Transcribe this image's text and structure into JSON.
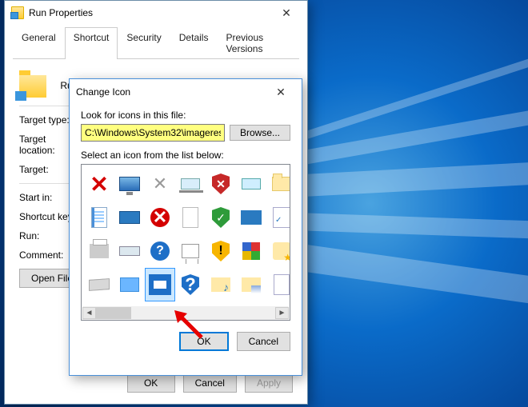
{
  "wallpaper": {
    "accent": "#0078d7"
  },
  "properties_window": {
    "title": "Run Properties",
    "tabs": [
      "General",
      "Shortcut",
      "Security",
      "Details",
      "Previous Versions"
    ],
    "active_tab": "Shortcut",
    "shortcut_name": "Run",
    "fields": {
      "target_type_label": "Target type:",
      "target_location_label": "Target location:",
      "target_label": "Target:",
      "start_in_label": "Start in:",
      "shortcut_key_label": "Shortcut key:",
      "run_label": "Run:",
      "comment_label": "Comment:"
    },
    "buttons": {
      "open_file_location": "Open File Location",
      "ok": "OK",
      "cancel": "Cancel",
      "apply": "Apply"
    }
  },
  "change_icon_dialog": {
    "title": "Change Icon",
    "look_for_label": "Look for icons in this file:",
    "path_value": "C:\\Windows\\System32\\imageres.dll",
    "browse_label": "Browse...",
    "select_label": "Select an icon from the list below:",
    "selected_index": 16,
    "ok_label": "OK",
    "cancel_label": "Cancel",
    "icons": [
      "red-x",
      "monitor",
      "gray-x",
      "laptop",
      "shield-red-x",
      "laptop-green",
      "folder",
      "document-blue",
      "tablet",
      "circle-red-x",
      "page",
      "shield-green-check",
      "rect-blue",
      "checklist",
      "printer",
      "scanner",
      "circle-blue-question",
      "projector-board",
      "shield-yellow-exclaim",
      "blocks",
      "star-person",
      "drive",
      "folder-blue",
      "window-blue",
      "shield-blue-question",
      "music-folder",
      "image-folder",
      "list-document"
    ]
  }
}
